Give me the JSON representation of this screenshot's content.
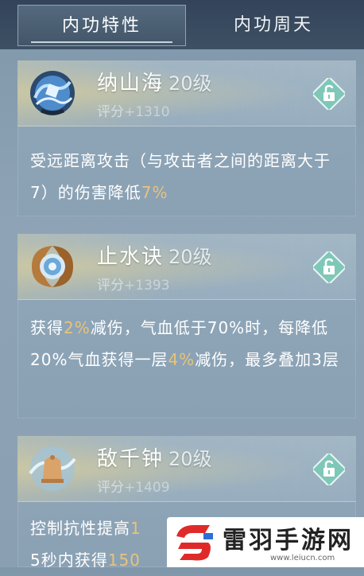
{
  "tabs": {
    "active": "内功特性",
    "inactive": "内功周天"
  },
  "skills": [
    {
      "name": "纳山海",
      "level": "20级",
      "score_label": "评分",
      "score_value": "+1310",
      "desc_parts": [
        "受远距离攻击（与攻击者之间的距离大于7）的伤害降低",
        "7%"
      ],
      "icon": "wave-orb-icon"
    },
    {
      "name": "止水诀",
      "level": "20级",
      "score_label": "评分",
      "score_value": "+1393",
      "desc_parts": [
        "获得",
        "2%",
        "减伤，气血低于70%时，每降低20%气血获得一层",
        "4%",
        "减伤，最多叠加3层"
      ],
      "icon": "water-shield-icon"
    },
    {
      "name": "敌千钟",
      "level": "20级",
      "score_label": "评分",
      "score_value": "+1409",
      "desc_parts": [
        "控制抗性提高",
        "1",
        "5秒内获得",
        "150"
      ],
      "icon": "bell-icon"
    }
  ],
  "watermark": {
    "title": "雷羽手游网",
    "url": "www.leiucn.com"
  },
  "colors": {
    "highlight": "#e8c37a",
    "tab_bar": "#33445a",
    "card_bg": "#8fa6b8"
  }
}
